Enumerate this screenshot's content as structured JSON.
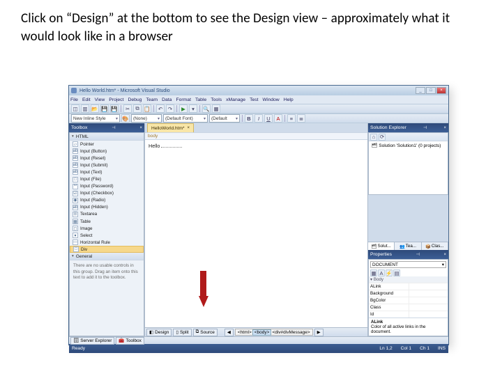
{
  "caption": "Click on “Design” at the bottom to see the Design view – approximately what it would look like in a browser",
  "title": "Hello World.htm* - Microsoft Visual Studio",
  "menu": [
    "File",
    "Edit",
    "View",
    "Project",
    "Debug",
    "Team",
    "Data",
    "Format",
    "Table",
    "Tools",
    "xManage",
    "Test",
    "Window",
    "Help"
  ],
  "styleDrop": {
    "newStyle": "New Inline Style",
    "apply": "(None)",
    "font": "(Default Font)",
    "size": "(Default"
  },
  "fmt": {
    "b": "B",
    "i": "I",
    "u": "U"
  },
  "panels": {
    "toolbox": "Toolbox",
    "sol": "Solution Explorer",
    "props": "Properties"
  },
  "toolboxGroups": {
    "html": "HTML",
    "general": "General"
  },
  "toolboxItems": [
    "Pointer",
    "Input (Button)",
    "Input (Reset)",
    "Input (Submit)",
    "Input (Text)",
    "Input (File)",
    "Input (Password)",
    "Input (Checkbox)",
    "Input (Radio)",
    "Input (Hidden)",
    "Textarea",
    "Table",
    "Image",
    "Select",
    "Horizontal Rule",
    "Div"
  ],
  "toolboxIcons": [
    "▱",
    "ab",
    "ab",
    "ab",
    "ab",
    "□",
    "**",
    "☑",
    "◉",
    "ab",
    "☰",
    "▦",
    "◻",
    "▾",
    "—",
    "□"
  ],
  "noControls": "There are no usable controls in this group. Drag an item onto this text to add it to the toolbox.",
  "docTab": "HelloWorld.htm*",
  "tagbar": "body",
  "docText": "Hello",
  "viewTabs": {
    "design": "Design",
    "split": "Split",
    "source": "Source"
  },
  "breadcrumb": {
    "html": "<html>",
    "body": "<body>",
    "div": "<div#divMessage>"
  },
  "bottomPanels": {
    "server": "Server Explorer",
    "toolpane": "Toolbox"
  },
  "solution": {
    "root": "Solution 'Solution1' (0 projects)"
  },
  "midTabs": [
    "Solut...",
    "Tea...",
    "Clas..."
  ],
  "propsDD": "DOCUMENT",
  "propRows": [
    {
      "k": "ALink",
      "v": ""
    },
    {
      "k": "Background",
      "v": ""
    },
    {
      "k": "BgColor",
      "v": ""
    },
    {
      "k": "Class",
      "v": ""
    },
    {
      "k": "Id",
      "v": ""
    }
  ],
  "propGroup": "Body",
  "propHelp": {
    "t": "ALink",
    "d": "Color of all active links in the document."
  },
  "status": {
    "ready": "Ready",
    "ln": "Ln 1,2",
    "col": "Col 1",
    "ch": "Ch 1",
    "ins": "INS"
  }
}
